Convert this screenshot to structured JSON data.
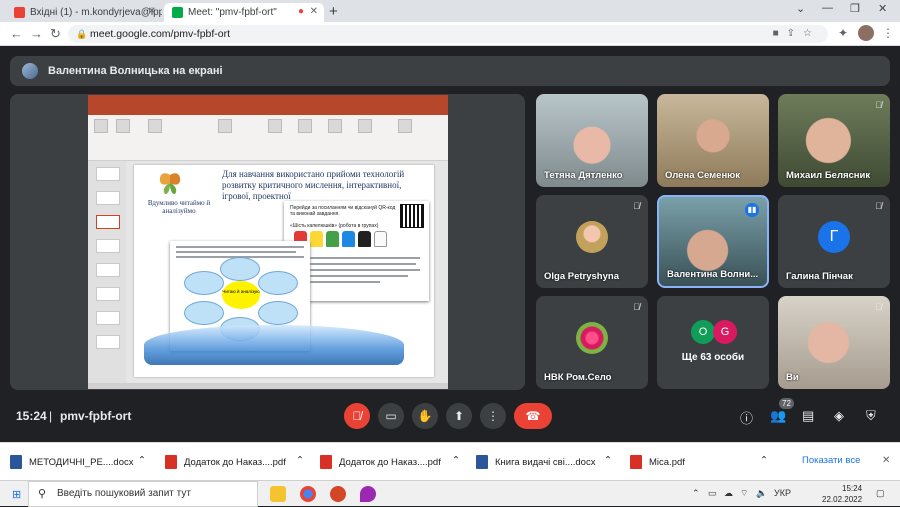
{
  "browser": {
    "tabs": [
      {
        "title": "Вхідні (1) - m.kondyrjeva@ippo...",
        "active": false
      },
      {
        "title": "Meet: \"pmv-fpbf-ort\"",
        "active": true
      }
    ],
    "url": "meet.google.com/pmv-fpbf-ort",
    "colors": {
      "gmail": "#ea4335",
      "meet": "#00ac47",
      "record": "#ea4335"
    }
  },
  "presentation": {
    "banner": "Валентина Волницька на екрані",
    "slide": {
      "title": "Для навчання використано прийоми технологій розвитку критичного мислення, інтерактивної, ігрової, проектної",
      "left_caption": "Вдумливо читаймо й аналізуймо",
      "card_item1": "Перейди за посиланням чи відскануй QR-код та виконай завдання.",
      "card_item2": "«Шість капелюшків» (робота в групах)",
      "flower_center": "Читаю й аналізую"
    }
  },
  "participants": [
    {
      "name": "Тетяна Дятленко",
      "kind": "video"
    },
    {
      "name": "Олена Семенюк",
      "kind": "video"
    },
    {
      "name": "Михаил Белясник",
      "kind": "video"
    },
    {
      "name": "Olga Petryshyna",
      "kind": "avatar-photo"
    },
    {
      "name": "Валентина Волни...",
      "kind": "video",
      "speaking": true
    },
    {
      "name": "Галина Пінчак",
      "kind": "avatar-letter",
      "initial": "Г"
    },
    {
      "name": "НВК Ром.Село",
      "kind": "avatar-flower"
    },
    {
      "name": "Ще 63 особи",
      "kind": "others",
      "initials": [
        "O",
        "G"
      ]
    },
    {
      "name": "Ви",
      "kind": "video"
    }
  ],
  "controls": {
    "time": "15:24",
    "separator": "|",
    "meeting_code": "pmv-fpbf-ort",
    "participant_count": "72"
  },
  "downloads": [
    {
      "name": "МЕТОДИЧНІ_РЕ....docx",
      "type": "docx"
    },
    {
      "name": "Додаток до Наказ....pdf",
      "type": "pdf"
    },
    {
      "name": "Додаток до Наказ....pdf",
      "type": "pdf"
    },
    {
      "name": "Книга видачі сві....docx",
      "type": "docx"
    },
    {
      "name": "Міса.pdf",
      "type": "pdf"
    }
  ],
  "downloads_show_all": "Показати все",
  "taskbar": {
    "search_placeholder": "Введіть пошуковий запит тут",
    "lang": "УКР",
    "time": "15:24",
    "date": "22.02.2022"
  }
}
